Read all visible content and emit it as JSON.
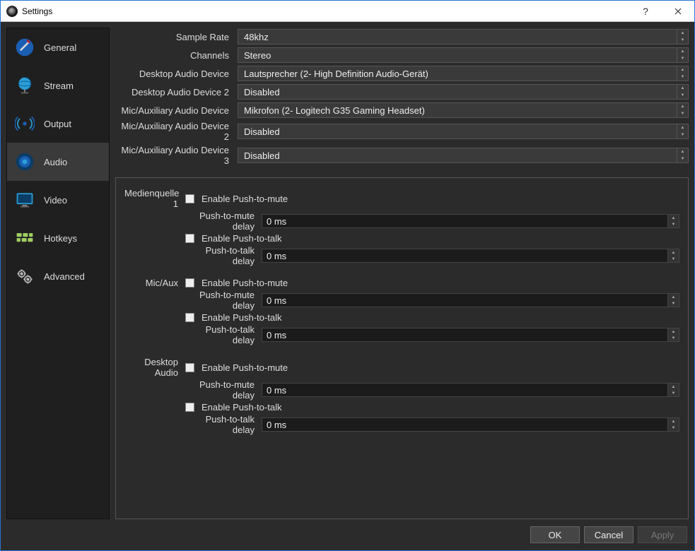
{
  "window": {
    "title": "Settings"
  },
  "sidebar": {
    "items": [
      {
        "label": "General"
      },
      {
        "label": "Stream"
      },
      {
        "label": "Output"
      },
      {
        "label": "Audio"
      },
      {
        "label": "Video"
      },
      {
        "label": "Hotkeys"
      },
      {
        "label": "Advanced"
      }
    ]
  },
  "devices": {
    "sample_rate": {
      "label": "Sample Rate",
      "value": "48khz"
    },
    "channels": {
      "label": "Channels",
      "value": "Stereo"
    },
    "desktop1": {
      "label": "Desktop Audio Device",
      "value": "Lautsprecher (2- High Definition Audio-Gerät)"
    },
    "desktop2": {
      "label": "Desktop Audio Device 2",
      "value": "Disabled"
    },
    "mic1": {
      "label": "Mic/Auxiliary Audio Device",
      "value": "Mikrofon (2- Logitech G35 Gaming Headset)"
    },
    "mic2": {
      "label": "Mic/Auxiliary Audio Device 2",
      "value": "Disabled"
    },
    "mic3": {
      "label": "Mic/Auxiliary Audio Device 3",
      "value": "Disabled"
    }
  },
  "sources": [
    {
      "name": "Medienquelle 1",
      "ptm_label": "Enable Push-to-mute",
      "ptm_delay_label": "Push-to-mute delay",
      "ptm_delay": "0 ms",
      "ptt_label": "Enable Push-to-talk",
      "ptt_delay_label": "Push-to-talk delay",
      "ptt_delay": "0 ms"
    },
    {
      "name": "Mic/Aux",
      "ptm_label": "Enable Push-to-mute",
      "ptm_delay_label": "Push-to-mute delay",
      "ptm_delay": "0 ms",
      "ptt_label": "Enable Push-to-talk",
      "ptt_delay_label": "Push-to-talk delay",
      "ptt_delay": "0 ms"
    },
    {
      "name": "Desktop Audio",
      "ptm_label": "Enable Push-to-mute",
      "ptm_delay_label": "Push-to-mute delay",
      "ptm_delay": "0 ms",
      "ptt_label": "Enable Push-to-talk",
      "ptt_delay_label": "Push-to-talk delay",
      "ptt_delay": "0 ms"
    }
  ],
  "footer": {
    "ok": "OK",
    "cancel": "Cancel",
    "apply": "Apply"
  }
}
